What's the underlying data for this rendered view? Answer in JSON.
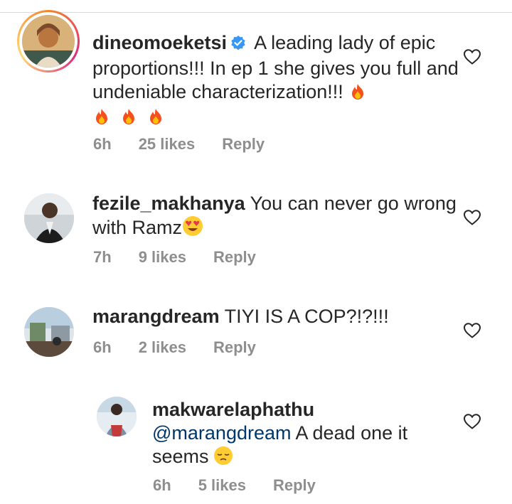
{
  "comments": [
    {
      "username": "dineomoeketsi",
      "verified": true,
      "text": "A leading lady of epic proportions!!! In ep 1 she gives you full and undeniable characterization!!!",
      "emoji_end": "fire",
      "emoji_line": [
        "fire",
        "fire",
        "fire"
      ],
      "time": "6h",
      "likes": "25 likes",
      "reply": "Reply"
    },
    {
      "username": "fezile_makhanya",
      "text": "You can never go wrong with Ramz",
      "emoji_end": "heart-eyes",
      "time": "7h",
      "likes": "9 likes",
      "reply": "Reply"
    },
    {
      "username": "marangdream",
      "text": "TIYI IS A COP?!?!!!",
      "time": "6h",
      "likes": "2 likes",
      "reply": "Reply"
    },
    {
      "username": "makwarelaphathu",
      "mention": "@marangdream",
      "text": "A dead one it seems",
      "emoji_end": "pensive-face",
      "time": "6h",
      "likes": "5 likes",
      "reply": "Reply"
    }
  ]
}
